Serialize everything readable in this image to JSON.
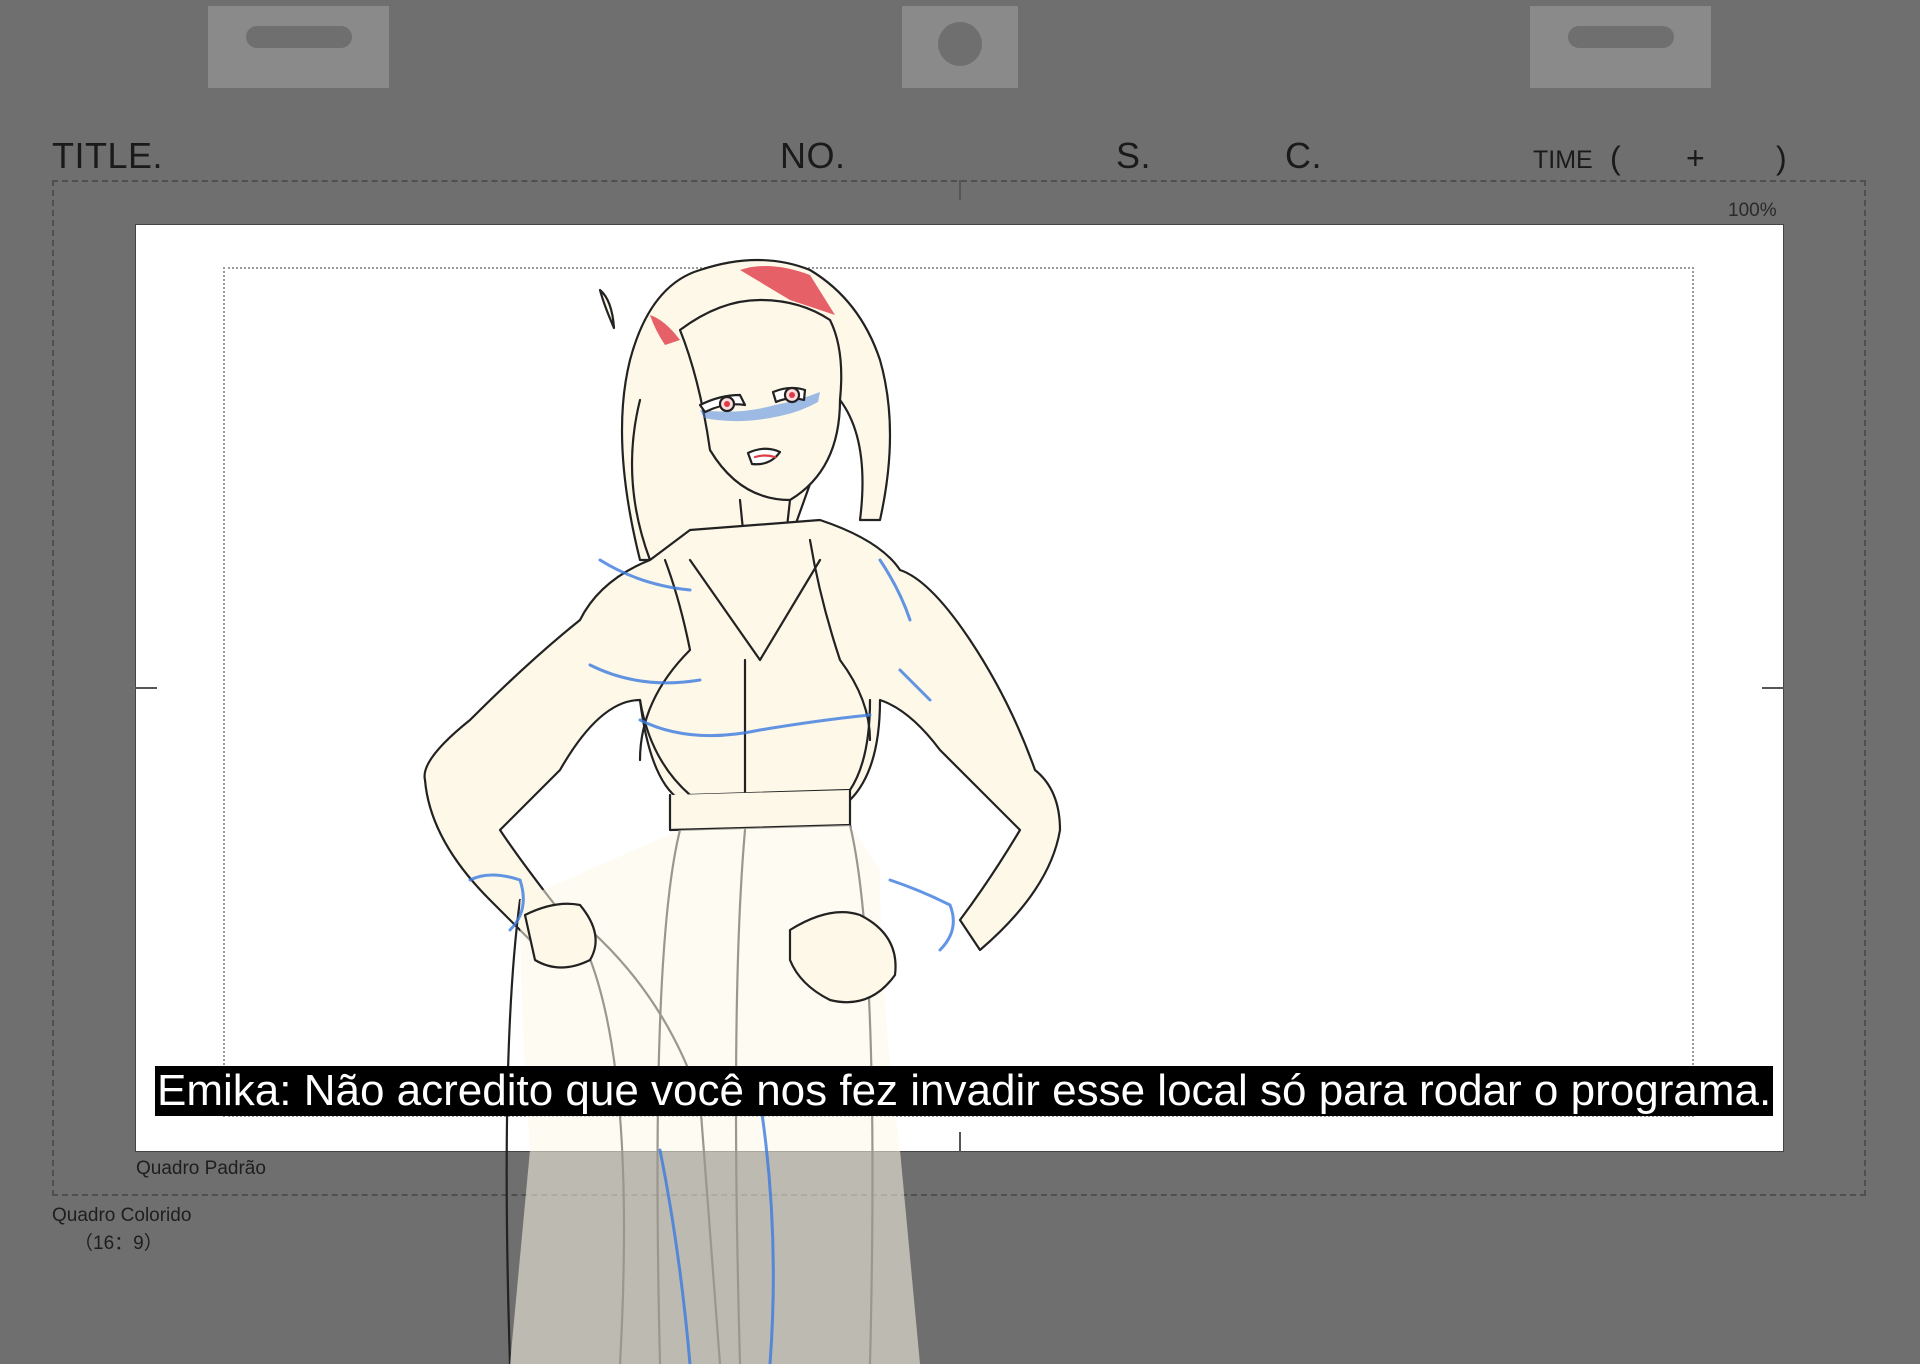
{
  "header": {
    "title_label": "TITLE.",
    "no_label": "NO.",
    "s_label": "S.",
    "c_label": "C.",
    "time_label": "TIME",
    "time_open": "(",
    "time_plus": "+",
    "time_close": ")"
  },
  "zoom": "100%",
  "subtitle": "Emika: Não acredito que você nos fez invadir esse local só para rodar o programa.",
  "frame_labels": {
    "default_frame": "Quadro Padrão",
    "color_frame": "Quadro Colorido",
    "ratio": "（16：9）"
  },
  "colors": {
    "background": "#6f6f6f",
    "paper": "#ffffff",
    "skin_fill": "#fdf8e8",
    "shadow_blue": "#3b7be0",
    "accent_red": "#e03a46"
  }
}
